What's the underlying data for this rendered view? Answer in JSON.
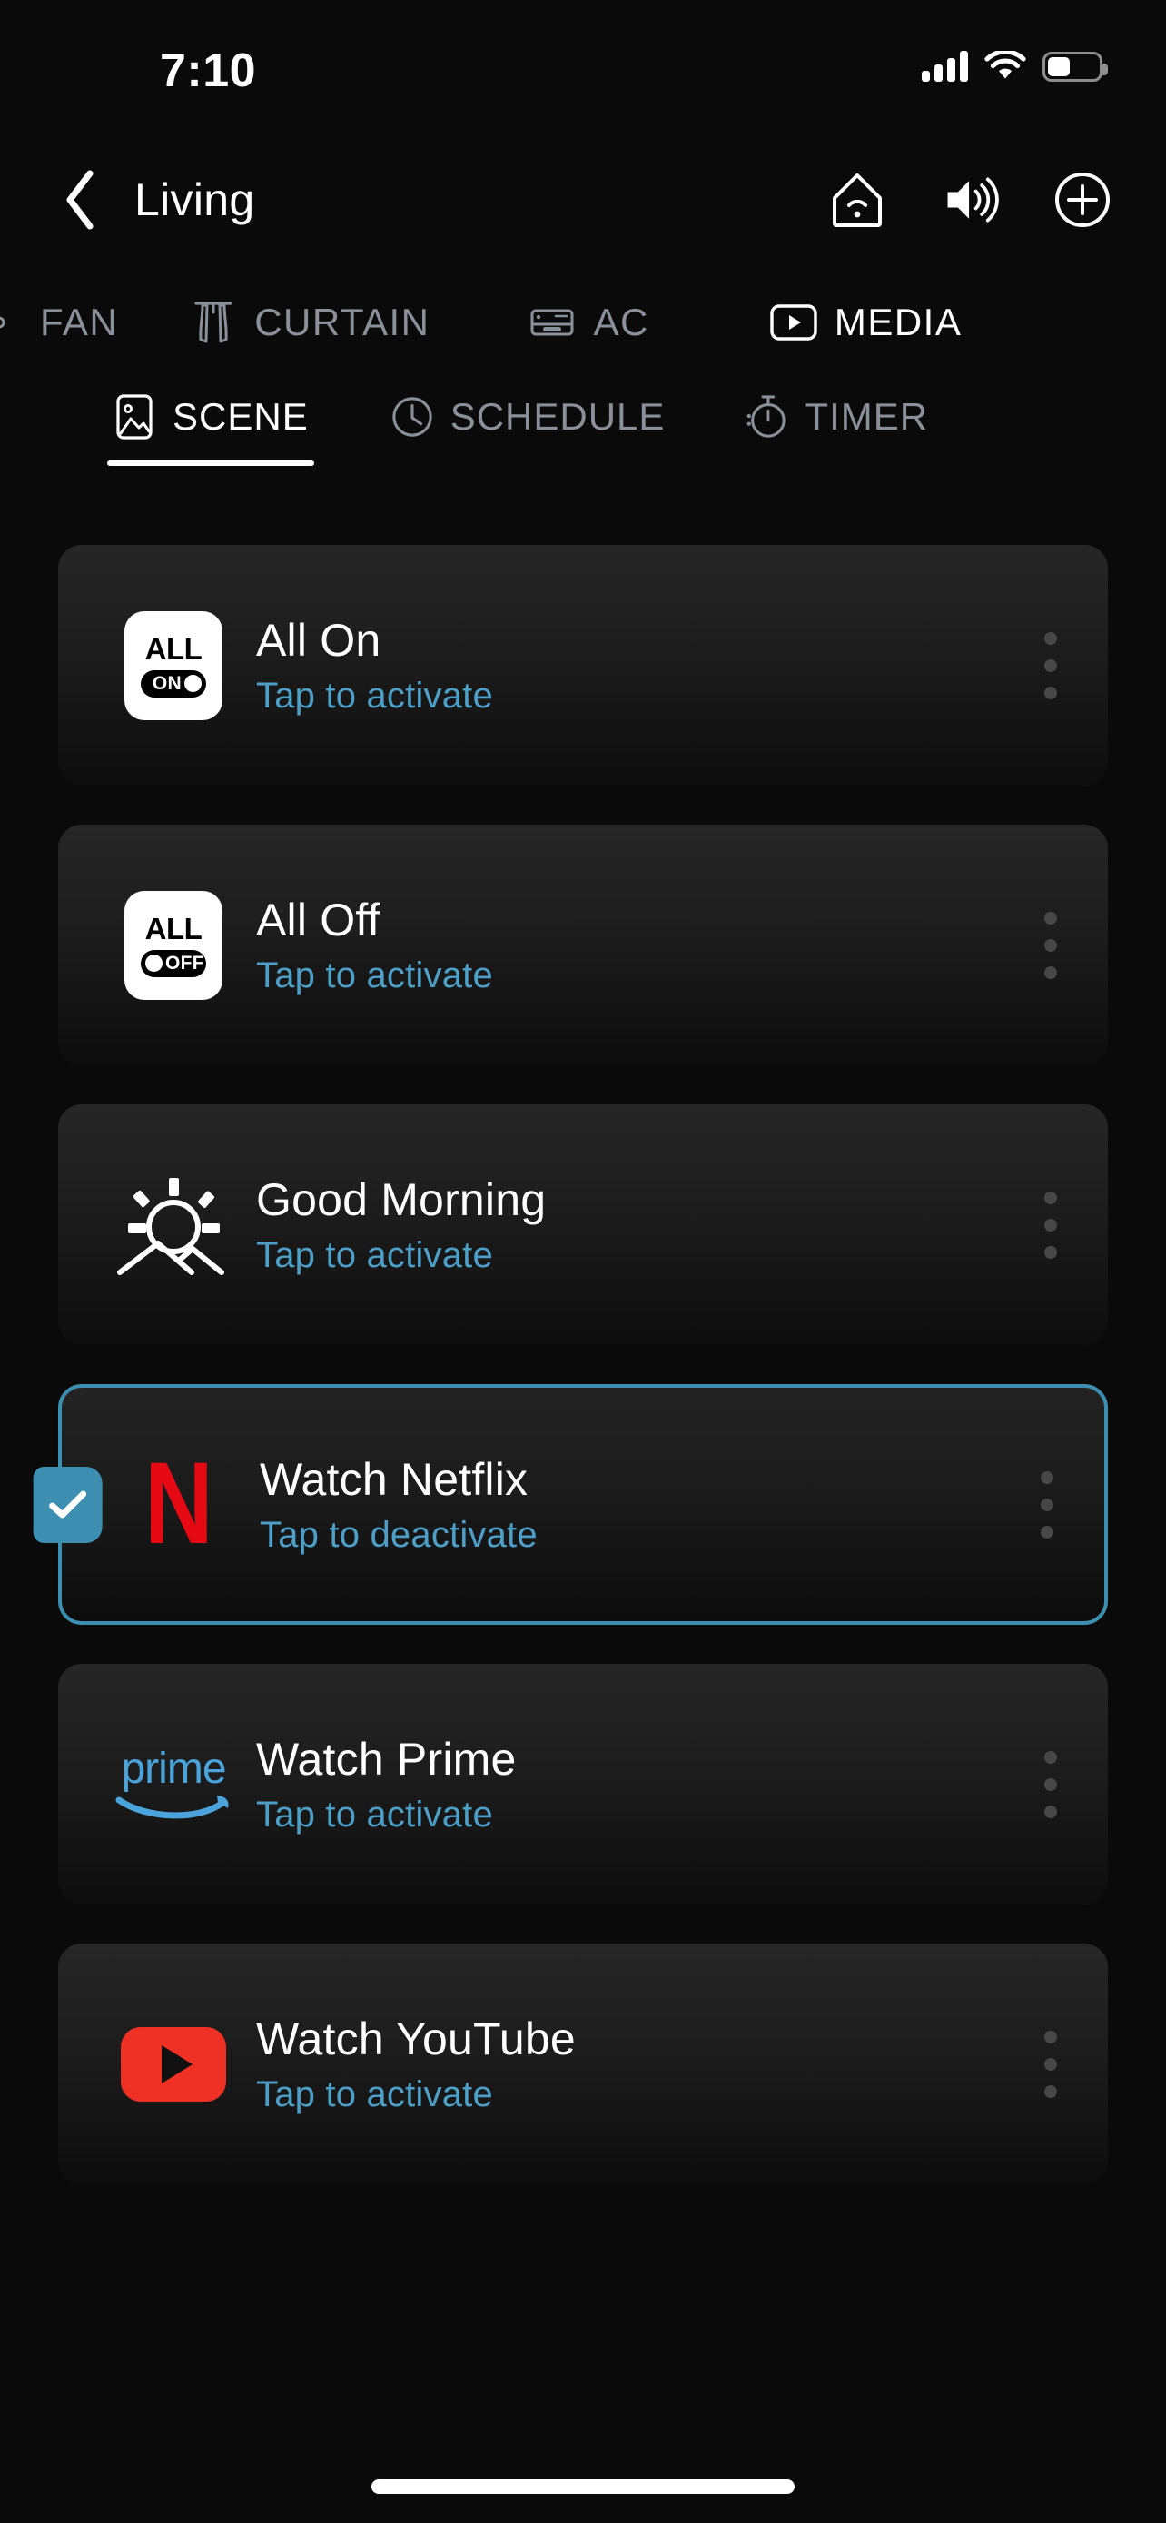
{
  "status_bar": {
    "time": "7:10",
    "signal_icon": "cellular-signal-icon",
    "wifi_icon": "wifi-icon",
    "battery_icon": "battery-icon",
    "battery_level_percent": 45
  },
  "header": {
    "back_icon": "chevron-left-icon",
    "title": "Living",
    "actions": [
      {
        "name": "home-wifi-icon",
        "label": "Home Wi-Fi"
      },
      {
        "name": "speaker-icon",
        "label": "Volume"
      },
      {
        "name": "plus-circle-icon",
        "label": "Add"
      }
    ]
  },
  "categories": {
    "items": [
      {
        "label": "FAN",
        "icon": "fan-icon",
        "active": false
      },
      {
        "label": "CURTAIN",
        "icon": "curtain-icon",
        "active": false
      },
      {
        "label": "AC",
        "icon": "air-conditioner-icon",
        "active": false
      },
      {
        "label": "MEDIA",
        "icon": "media-play-icon",
        "active": true
      }
    ]
  },
  "sub_tabs": {
    "items": [
      {
        "label": "SCENE",
        "icon": "image-scene-icon",
        "active": true
      },
      {
        "label": "SCHEDULE",
        "icon": "clock-icon",
        "active": false
      },
      {
        "label": "TIMER",
        "icon": "stopwatch-icon",
        "active": false
      }
    ]
  },
  "scenes": {
    "items": [
      {
        "title": "All On",
        "subtitle": "Tap to activate",
        "icon": "all-on-icon",
        "icon_label": "ALL",
        "toggle_label": "ON",
        "selected": false
      },
      {
        "title": "All Off",
        "subtitle": "Tap to activate",
        "icon": "all-off-icon",
        "icon_label": "ALL",
        "toggle_label": "OFF",
        "selected": false
      },
      {
        "title": "Good Morning",
        "subtitle": "Tap to activate",
        "icon": "sunrise-icon",
        "selected": false
      },
      {
        "title": "Watch Netflix",
        "subtitle": "Tap to deactivate",
        "icon": "netflix-icon",
        "logo_letter": "N",
        "selected": true
      },
      {
        "title": "Watch Prime",
        "subtitle": "Tap to activate",
        "icon": "prime-video-icon",
        "logo_word": "prime",
        "selected": false
      },
      {
        "title": "Watch YouTube",
        "subtitle": "Tap to activate",
        "icon": "youtube-icon",
        "selected": false
      }
    ],
    "menu_icon": "more-vertical-icon",
    "check_icon": "check-icon"
  },
  "colors": {
    "accent_blue": "#4d9fc8",
    "selected_border": "#3d8fb2",
    "netflix_red": "#E50914",
    "youtube_red": "#EE3124",
    "prime_blue": "#4BA3DB",
    "background": "#0a0a0a",
    "card_top": "#262626",
    "card_bottom": "#0d0d0d"
  },
  "home_indicator": "home-indicator"
}
